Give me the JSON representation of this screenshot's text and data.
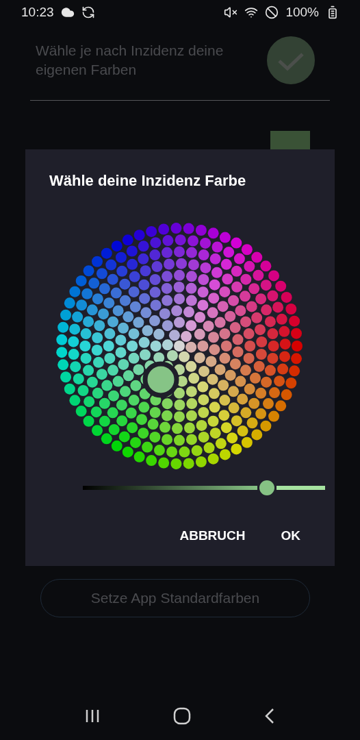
{
  "status_bar": {
    "time": "10:23",
    "battery": "100%"
  },
  "settings": {
    "toggle_text": "Wähle je nach Inzidenz deine eigenen Farben",
    "toggle_checked": true,
    "color_rows": [
      {
        "color": "#3a5236"
      }
    ]
  },
  "reset_button": "Setze App Standardfarben",
  "dialog": {
    "title": "Wähle deine Inzidenz Farbe",
    "brightness": {
      "level": 0.76
    },
    "buttons": [
      "ABBRUCH",
      "OK"
    ]
  }
}
